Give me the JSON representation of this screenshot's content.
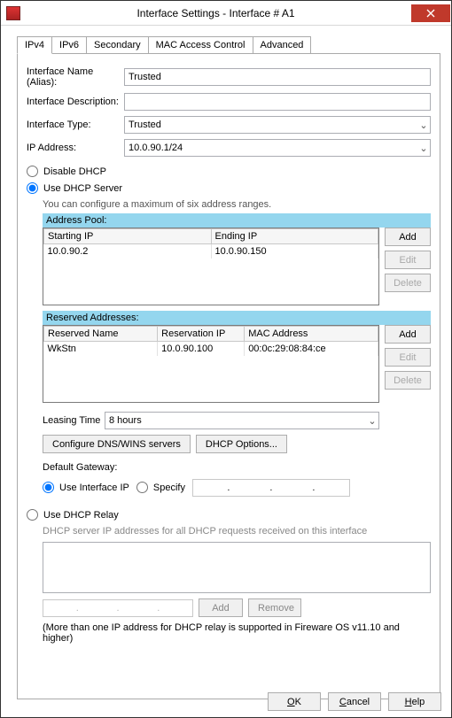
{
  "window": {
    "title": "Interface Settings - Interface # A1"
  },
  "tabs": {
    "ipv4": "IPv4",
    "ipv6": "IPv6",
    "secondary": "Secondary",
    "mac": "MAC Access Control",
    "advanced": "Advanced"
  },
  "fields": {
    "name_label": "Interface Name (Alias):",
    "name_value": "Trusted",
    "desc_label": "Interface Description:",
    "desc_value": "",
    "type_label": "Interface Type:",
    "type_value": "Trusted",
    "ip_label": "IP Address:",
    "ip_value": "10.0.90.1/24"
  },
  "dhcp": {
    "disable_label": "Disable DHCP",
    "server_label": "Use DHCP Server",
    "relay_label": "Use DHCP Relay",
    "hint": "You can configure a maximum of six address ranges.",
    "pool_title": "Address Pool:",
    "pool_cols": {
      "start": "Starting IP",
      "end": "Ending IP"
    },
    "pool_rows": [
      {
        "start": "10.0.90.2",
        "end": "10.0.90.150"
      }
    ],
    "reserved_title": "Reserved Addresses:",
    "reserved_cols": {
      "name": "Reserved Name",
      "ip": "Reservation IP",
      "mac": "MAC Address"
    },
    "reserved_rows": [
      {
        "name": "WkStn",
        "ip": "10.0.90.100",
        "mac": "00:0c:29:08:84:ce"
      }
    ],
    "btns": {
      "add": "Add",
      "edit": "Edit",
      "delete": "Delete"
    },
    "lease_label": "Leasing Time",
    "lease_value": "8 hours",
    "dns_btn": "Configure DNS/WINS servers",
    "opts_btn": "DHCP Options...",
    "gw_label": "Default Gateway:",
    "gw_useif": "Use Interface IP",
    "gw_specify": "Specify",
    "relay_hint": "DHCP server IP addresses for all DHCP requests received on this interface",
    "relay_add": "Add",
    "relay_remove": "Remove",
    "relay_note": "(More than one IP address for DHCP relay is supported in Fireware OS v11.10 and higher)"
  },
  "dlg": {
    "ok": "OK",
    "cancel": "Cancel",
    "help": "Help"
  },
  "ip_dots": ".",
  "underline": {
    "o": "O",
    "c": "C",
    "h": "H"
  }
}
